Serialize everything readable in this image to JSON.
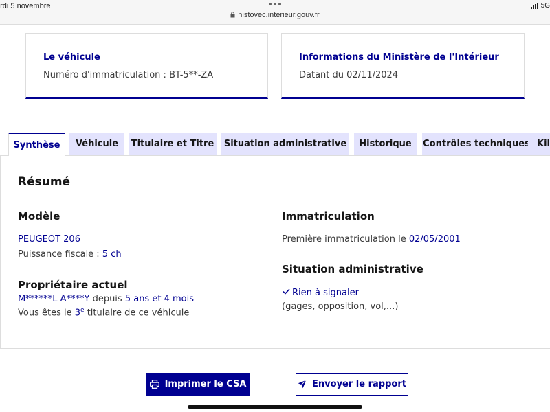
{
  "statusbar": {
    "date": "ardi 5 novembre",
    "url": "histovec.interieur.gouv.fr",
    "network": "5G"
  },
  "cards": {
    "vehicle": {
      "title": "Le véhicule",
      "plate": "Numéro d'immatriculation : BT-5**-ZA"
    },
    "ministry": {
      "title": "Informations du Ministère de l'Intérieur",
      "date": "Datant du 02/11/2024"
    }
  },
  "tabs": [
    {
      "label": "Synthèse",
      "active": true
    },
    {
      "label": "Véhicule"
    },
    {
      "label": "Titulaire et Titre"
    },
    {
      "label": "Situation administrative"
    },
    {
      "label": "Historique"
    },
    {
      "label": "Contrôles techniques"
    },
    {
      "label": "Kil"
    }
  ],
  "summary": {
    "title": "Résumé",
    "model": {
      "heading": "Modèle",
      "name": "PEUGEOT 206",
      "power_label": "Puissance fiscale : ",
      "power_value": "5 ch"
    },
    "owner": {
      "heading": "Propriétaire actuel",
      "name": "M******L A****Y",
      "since_label": " depuis ",
      "since_value": "5 ans et 4 mois",
      "rank_prefix": "Vous êtes le ",
      "rank_num": "3",
      "rank_sup": "e",
      "rank_suffix": " titulaire de ce véhicule"
    },
    "registration": {
      "heading": "Immatriculation",
      "first_label": "Première immatriculation le ",
      "first_date": "02/05/2001"
    },
    "admin": {
      "heading": "Situation administrative",
      "status": "Rien à signaler",
      "details": "(gages, opposition, vol,...)"
    }
  },
  "actions": {
    "print": "Imprimer le CSA",
    "send": "Envoyer le rapport"
  },
  "colors": {
    "primary": "#000091",
    "tab_bg": "#e3e3fd"
  }
}
